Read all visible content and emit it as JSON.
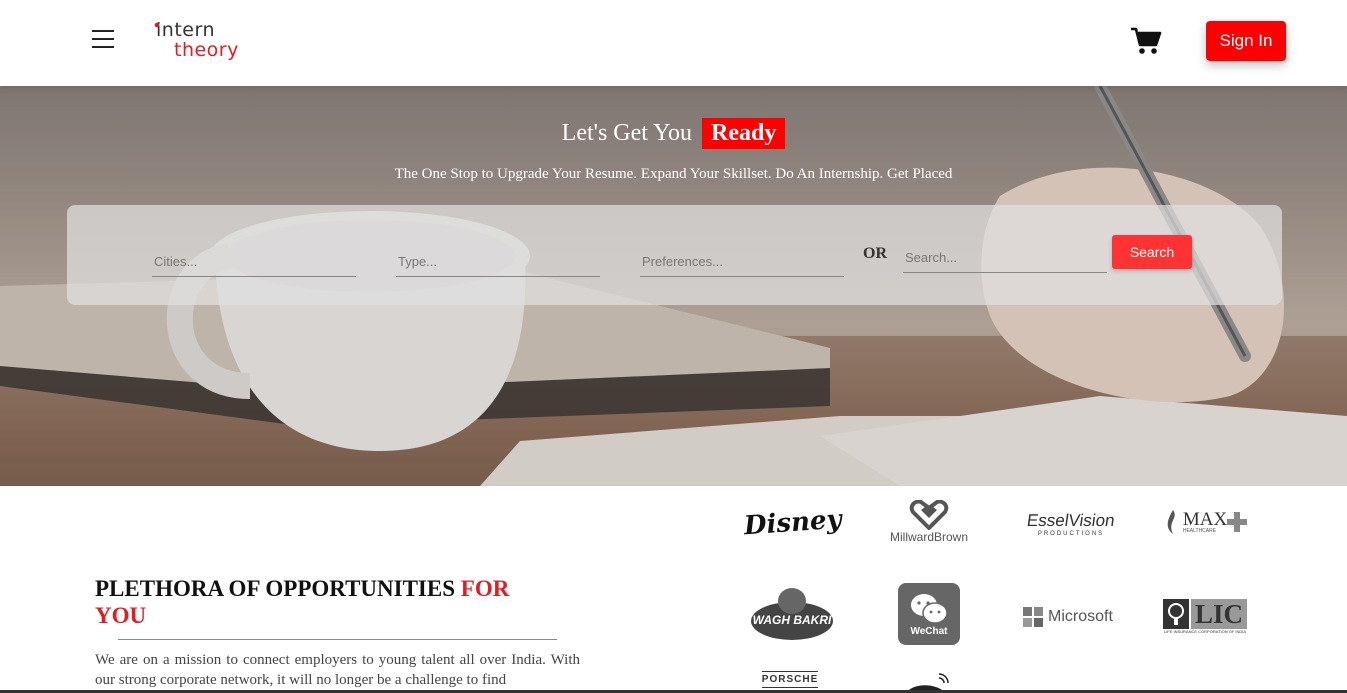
{
  "header": {
    "logo_line1": "intern",
    "logo_line2": "theory",
    "signin_label": "Sign In",
    "icons": [
      "menu-icon",
      "cart-icon"
    ],
    "accent_color": "#ff0000"
  },
  "hero": {
    "title": "Let's Get You",
    "title_highlight": "Ready",
    "subtitle": "The One Stop to Upgrade Your Resume. Expand Your Skillset. Do An Internship. Get Placed",
    "search": {
      "cities_placeholder": "Cities...",
      "type_placeholder": "Type...",
      "preferences_placeholder": "Preferences...",
      "or_label": "OR",
      "search_placeholder": "Search...",
      "search_button": "Search"
    }
  },
  "section": {
    "title_black": "PLETHORA OF OPPORTUNITIES",
    "title_red_1": "FOR",
    "title_red_2": "YOU",
    "body": "We are on a mission to connect employers to young talent all over India. With our strong corporate network, it will no longer be a challenge to find"
  },
  "brands": {
    "disney": "Disney",
    "millward": "MillwardBrown",
    "essel": "EsselVision",
    "essel_sub": "PRODUCTIONS",
    "max": "MAX",
    "max_sub": "HEALTHCARE",
    "waghbakri": "WAGH BAKRI",
    "wechat": "WeChat",
    "microsoft": "Microsoft",
    "lic": "LIC",
    "lic_sub": "LIFE INSURANCE CORPORATION OF INDIA",
    "porsche": "PORSCHE"
  }
}
